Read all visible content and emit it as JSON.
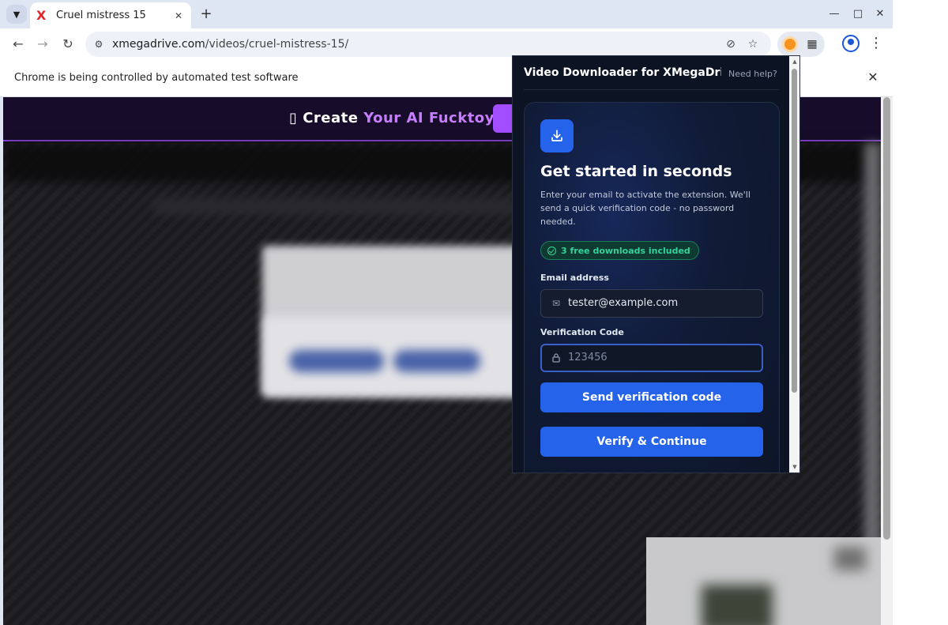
{
  "browser": {
    "tab_title": "Cruel mistress 15",
    "tab_favicon": "X",
    "url_domain": "xmegadrive.com",
    "url_path": "/videos/cruel-mistress-15/",
    "infobar_text": "Chrome is being controlled by automated test software"
  },
  "page": {
    "promo_icon": "▯",
    "promo_text_plain": "Create",
    "promo_text_accent": "Your AI Fucktoy"
  },
  "popup": {
    "title": "Video Downloader for XMegaDri...",
    "help_link": "Need help?",
    "heading": "Get started in seconds",
    "description": "Enter your email to activate the extension. We'll send a quick verification code - no password needed.",
    "badge": "3 free downloads included",
    "email_label": "Email address",
    "email_value": "tester@example.com",
    "code_label": "Verification Code",
    "code_placeholder": "123456",
    "send_button": "Send verification code",
    "verify_button": "Verify & Continue"
  },
  "colors": {
    "accent_blue": "#2563eb",
    "success_green": "#34d399",
    "promo_purple": "#a24dff"
  },
  "icons": [
    "tab-list-icon",
    "close-icon",
    "plus-icon",
    "minimize-icon",
    "maximize-icon",
    "back-icon",
    "forward-icon",
    "reload-icon",
    "site-info-icon",
    "eye-off-icon",
    "star-icon",
    "extension-icon",
    "puzzle-icon",
    "profile-icon",
    "menu-icon",
    "download-icon",
    "check-circle-icon",
    "mail-icon",
    "lock-icon"
  ]
}
